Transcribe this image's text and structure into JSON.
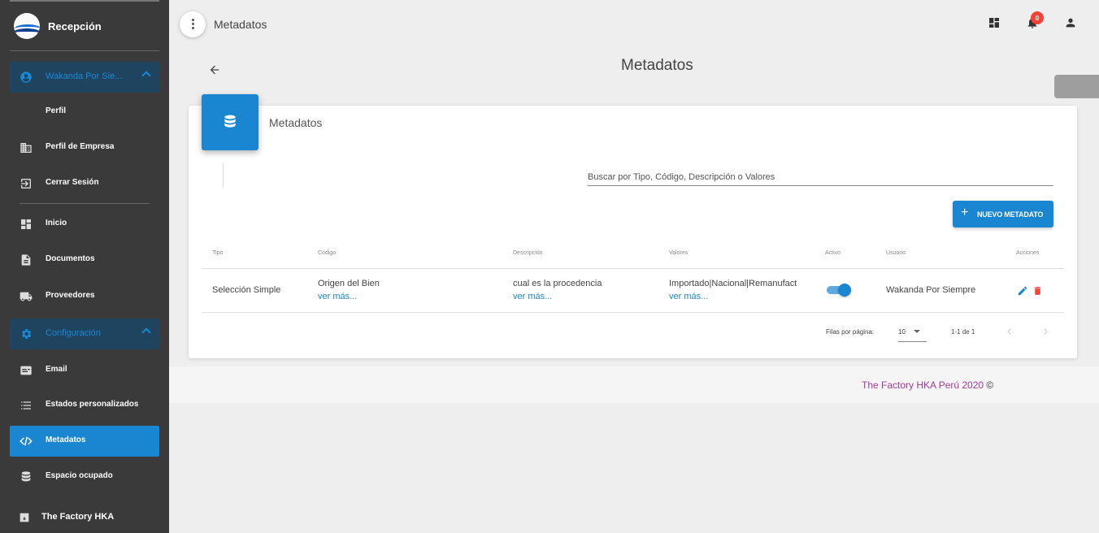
{
  "sidebar": {
    "brand": "Recepción",
    "user_group": "Wakanda Por Sie...",
    "items": {
      "perfil": "Perfil",
      "perfil_empresa": "Perfil de Empresa",
      "cerrar_sesion": "Cerrar Sesión",
      "inicio": "Inicio",
      "documentos": "Documentos",
      "proveedores": "Proveedores",
      "configuracion": "Configuración",
      "email": "Email",
      "estados": "Estados personalizados",
      "metadatos": "Metadatos",
      "espacio": "Espacio ocupado",
      "factory": "The Factory HKA"
    }
  },
  "topbar": {
    "title": "Metadatos",
    "notifications_count": "0"
  },
  "page": {
    "title": "Metadatos"
  },
  "card": {
    "title": "Metadatos",
    "search_placeholder": "Buscar por Tipo, Código, Descripción o Valores",
    "new_button": "NUEVO METADATO",
    "columns": [
      "Tipo",
      "Código",
      "Descripción",
      "Valores",
      "Activo",
      "Usuario",
      "Acciones"
    ],
    "rows": [
      {
        "tipo": "Selección Simple",
        "codigo": "Origen del Bien",
        "descripcion": "cual es la procedencia",
        "valores": "Importado|Nacional|Remanufact",
        "activo": true,
        "usuario": "Wakanda Por Siempre"
      }
    ],
    "more_link": "ver más...",
    "pagination": {
      "rows_label": "Filas por página:",
      "rows_value": "10",
      "range": "1-1 de 1"
    }
  },
  "footer": {
    "text": "The Factory HKA Perú 2020",
    "copyright": "©"
  },
  "colors": {
    "accent": "#1a85d0",
    "sidebar_bg": "#3a3a3a",
    "footer_text": "#a23a9c",
    "delete": "#f44336"
  }
}
